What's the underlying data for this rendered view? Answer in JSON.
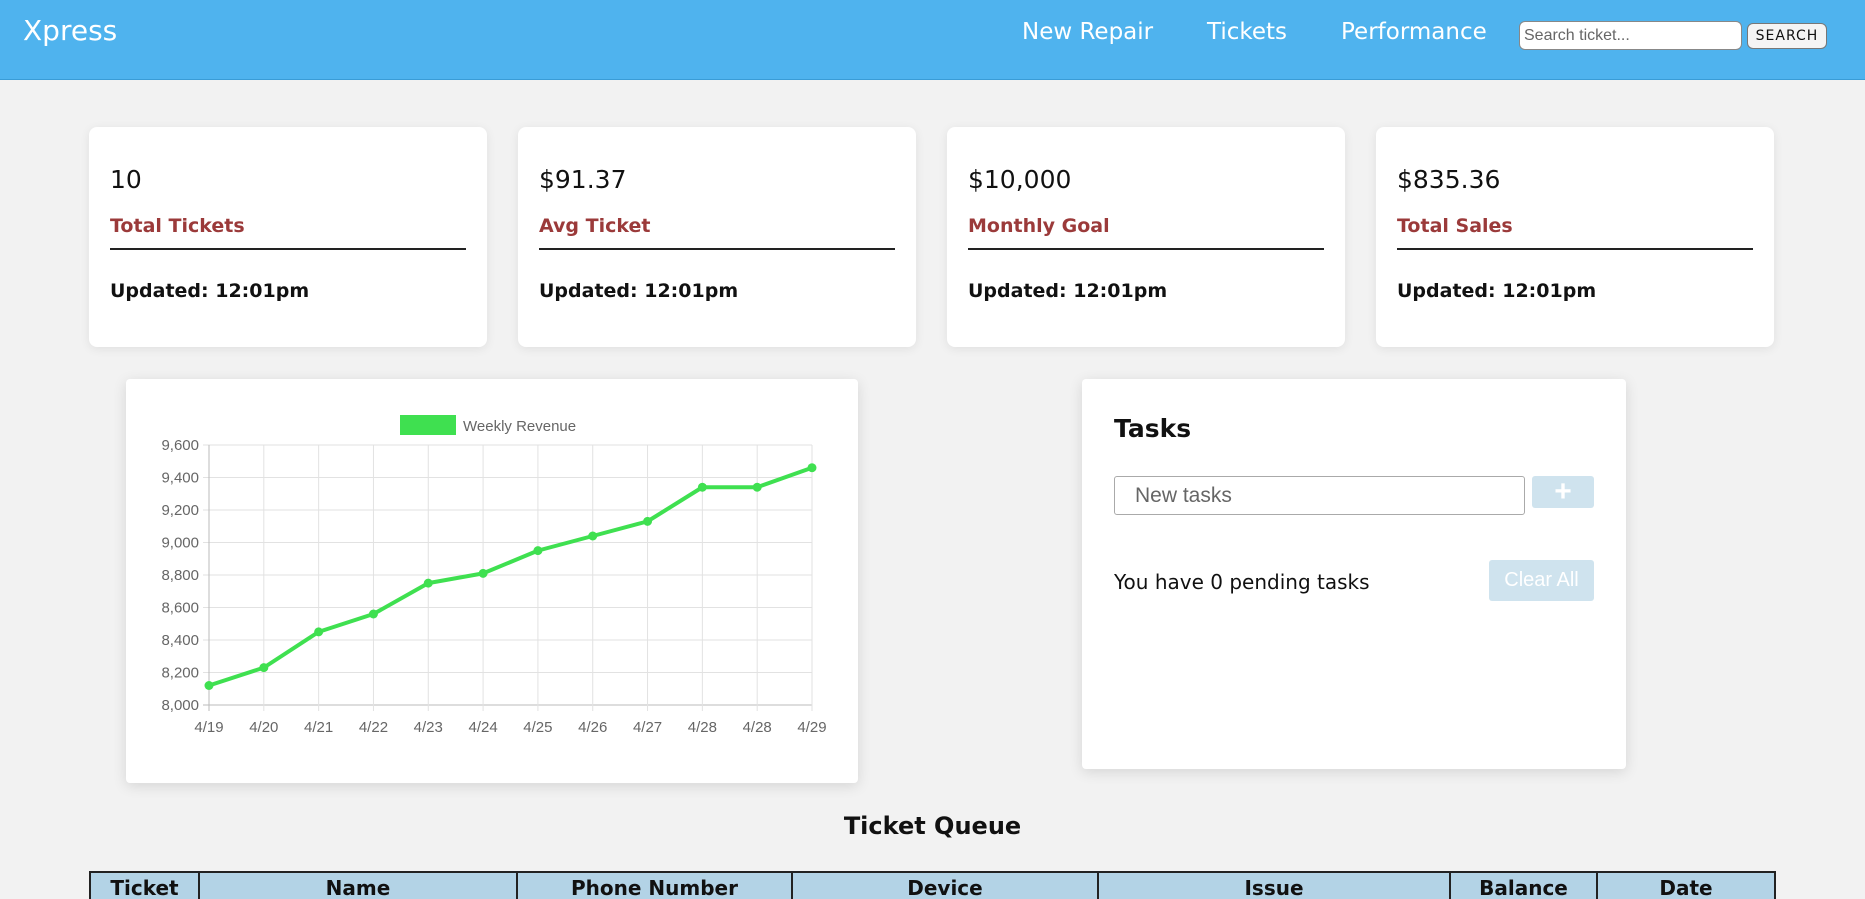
{
  "nav": {
    "brand": "Xpress",
    "links": [
      "New Repair",
      "Tickets",
      "Performance"
    ],
    "search_placeholder": "Search ticket...",
    "search_button": "SEARCH"
  },
  "stats": [
    {
      "value": "10",
      "label": "Total Tickets",
      "updated": "Updated: 12:01pm"
    },
    {
      "value": "$91.37",
      "label": "Avg Ticket",
      "updated": "Updated: 12:01pm"
    },
    {
      "value": "$10,000",
      "label": "Monthly Goal",
      "updated": "Updated: 12:01pm"
    },
    {
      "value": "$835.36",
      "label": "Total Sales",
      "updated": "Updated: 12:01pm"
    }
  ],
  "chart_data": {
    "type": "line",
    "x": [
      "4/19",
      "4/20",
      "4/21",
      "4/22",
      "4/23",
      "4/24",
      "4/25",
      "4/26",
      "4/27",
      "4/28",
      "4/28",
      "4/29"
    ],
    "series": [
      {
        "name": "Weekly Revenue",
        "color": "#3fe050",
        "values": [
          8120,
          8230,
          8450,
          8560,
          8750,
          8810,
          8950,
          9040,
          9130,
          9340,
          9340,
          9460
        ]
      }
    ],
    "ylim": [
      8000,
      9600
    ],
    "yticks": [
      "9,600",
      "9,400",
      "9,200",
      "9,000",
      "8,800",
      "8,600",
      "8,400",
      "8,200",
      "8,000"
    ],
    "grid": true,
    "legend_position": "top"
  },
  "tasks": {
    "title": "Tasks",
    "input_placeholder": "New tasks",
    "add_icon": "plus-icon",
    "pending_text": "You have 0 pending tasks",
    "clear_label": "Clear All"
  },
  "queue": {
    "title": "Ticket Queue",
    "columns": [
      "Ticket",
      "Name",
      "Phone Number",
      "Device",
      "Issue",
      "Balance",
      "Date"
    ]
  }
}
